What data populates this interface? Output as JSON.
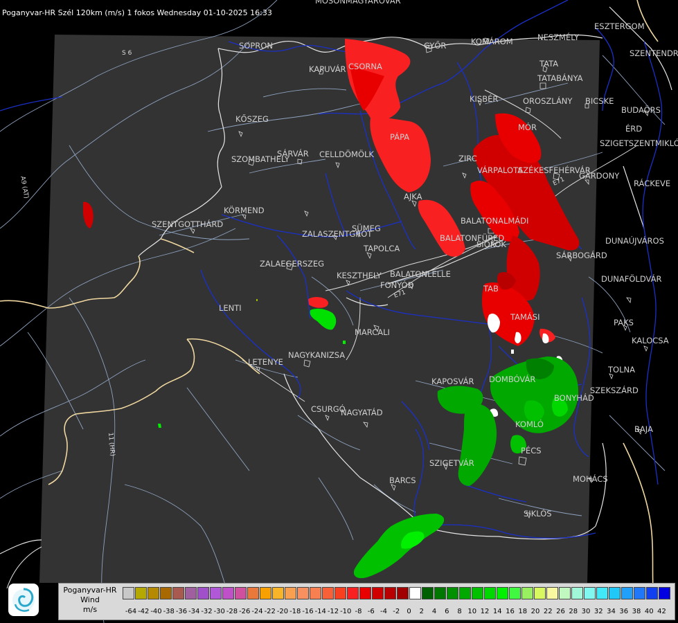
{
  "title": "Poganyvar-HR Szél 120km (m/s) 1 fokos Wednesday 01-10-2025 16:33",
  "legend": {
    "name_lines": [
      "Poganyvar-HR",
      "Wind",
      "m/s"
    ],
    "swatches": [
      {
        "v": "-64",
        "c": "#c8c8c8"
      },
      {
        "v": "-62",
        "c": "#b5a800"
      },
      {
        "v": "-42",
        "c": "#b58a00"
      },
      {
        "v": "-40",
        "c": "#a86a00"
      },
      {
        "v": "-38",
        "c": "#a85a50"
      },
      {
        "v": "-36",
        "c": "#a060a0"
      },
      {
        "v": "-34",
        "c": "#a050c8"
      },
      {
        "v": "-32",
        "c": "#b058d8"
      },
      {
        "v": "-30",
        "c": "#c050c8"
      },
      {
        "v": "-28",
        "c": "#d050a0"
      },
      {
        "v": "-26",
        "c": "#e8783c"
      },
      {
        "v": "-24",
        "c": "#f8a000"
      },
      {
        "v": "-22",
        "c": "#f8b428"
      },
      {
        "v": "-20",
        "c": "#f8a050"
      },
      {
        "v": "-18",
        "c": "#f89060"
      },
      {
        "v": "-16",
        "c": "#f88050"
      },
      {
        "v": "-14",
        "c": "#f86038"
      },
      {
        "v": "-12",
        "c": "#f84020"
      },
      {
        "v": "-10",
        "c": "#f82020"
      },
      {
        "v": "-8",
        "c": "#e80000"
      },
      {
        "v": "-6",
        "c": "#d00000"
      },
      {
        "v": "-4",
        "c": "#b80000"
      },
      {
        "v": "-2",
        "c": "#a00000"
      },
      {
        "v": "0",
        "c": "#ffffff"
      },
      {
        "v": "2",
        "c": "#006000"
      },
      {
        "v": "4",
        "c": "#007800"
      },
      {
        "v": "6",
        "c": "#009000"
      },
      {
        "v": "8",
        "c": "#00a800"
      },
      {
        "v": "10",
        "c": "#00c000"
      },
      {
        "v": "12",
        "c": "#00d800"
      },
      {
        "v": "14",
        "c": "#00f000"
      },
      {
        "v": "16",
        "c": "#40f840"
      },
      {
        "v": "18",
        "c": "#98f060"
      },
      {
        "v": "20",
        "c": "#d8f860"
      },
      {
        "v": "22",
        "c": "#f8f8a0"
      },
      {
        "v": "26",
        "c": "#c0f8c0"
      },
      {
        "v": "28",
        "c": "#a0f8d8"
      },
      {
        "v": "30",
        "c": "#80f8f0"
      },
      {
        "v": "32",
        "c": "#40e8f8"
      },
      {
        "v": "34",
        "c": "#20c8f8"
      },
      {
        "v": "36",
        "c": "#20a0f8"
      },
      {
        "v": "38",
        "c": "#2078f8"
      },
      {
        "v": "40",
        "c": "#1040f0"
      },
      {
        "v": "42",
        "c": "#0000e0"
      }
    ],
    "labels": [
      "-64",
      "-42",
      "-40",
      "-38",
      "-36",
      "-34",
      "-32",
      "-30",
      "-28",
      "-26",
      "-24",
      "-22",
      "-20",
      "-18",
      "-16",
      "-14",
      "-12",
      "-10",
      "-8",
      "-6",
      "-4",
      "-2",
      "0",
      "2",
      "4",
      "6",
      "8",
      "10",
      "12",
      "14",
      "16",
      "18",
      "20",
      "22",
      "26",
      "28",
      "30",
      "32",
      "34",
      "36",
      "38",
      "40",
      "42"
    ]
  },
  "places": [
    {
      "name": "MOSONMAGYARÓVÁR"
    },
    {
      "name": "SOPRON"
    },
    {
      "name": "KAPUVÁR"
    },
    {
      "name": "CSORNA"
    },
    {
      "name": "GYŐR"
    },
    {
      "name": "KOMÁROM"
    },
    {
      "name": "NESZMÉLY"
    },
    {
      "name": "ESZTERGOM"
    },
    {
      "name": "SZENTENDRE"
    },
    {
      "name": "TATA"
    },
    {
      "name": "TATABÁNYA"
    },
    {
      "name": "KISBÉR"
    },
    {
      "name": "OROSZLÁNY"
    },
    {
      "name": "BICSKE"
    },
    {
      "name": "BUDAÖRS"
    },
    {
      "name": "ÉRD"
    },
    {
      "name": "SZIGETSZENTMIKLÓS"
    },
    {
      "name": "MÓR"
    },
    {
      "name": "PÁPA"
    },
    {
      "name": "KŐSZEG"
    },
    {
      "name": "SÁRVÁR"
    },
    {
      "name": "CELLDÖMÖLK"
    },
    {
      "name": "SZOMBATHELY"
    },
    {
      "name": "ZIRC"
    },
    {
      "name": "VÁRPALOTA"
    },
    {
      "name": "SZÉKESFEHÉRVÁR"
    },
    {
      "name": "GÁRDONY"
    },
    {
      "name": "RÁCKEVE"
    },
    {
      "name": "AJKA"
    },
    {
      "name": "KÖRMEND"
    },
    {
      "name": "SZENTGOTTHÁRD"
    },
    {
      "name": "BALATONALMÁDI"
    },
    {
      "name": "SÜMEG"
    },
    {
      "name": "ZALASZENTGRÓT"
    },
    {
      "name": "BALATONFÜRED"
    },
    {
      "name": "SIÓFOK"
    },
    {
      "name": "DUNAÚJVÁROS"
    },
    {
      "name": "TAPOLCA"
    },
    {
      "name": "ZALAEGERSZEG"
    },
    {
      "name": "SÁRBOGÁRD"
    },
    {
      "name": "KESZTHELY"
    },
    {
      "name": "BALATONLELLE"
    },
    {
      "name": "FONYÓD"
    },
    {
      "name": "DUNAFÖLDVÁR"
    },
    {
      "name": "TAB"
    },
    {
      "name": "LENTI"
    },
    {
      "name": "TAMÁSI"
    },
    {
      "name": "PAKS"
    },
    {
      "name": "MARCALI"
    },
    {
      "name": "KALOCSA"
    },
    {
      "name": "NAGYKANIZSA"
    },
    {
      "name": "LETENYE"
    },
    {
      "name": "TOLNA"
    },
    {
      "name": "KAPOSVÁR"
    },
    {
      "name": "DOMBÓVÁR"
    },
    {
      "name": "SZEKSZÁRD"
    },
    {
      "name": "BONYHÁD"
    },
    {
      "name": "CSURGÓ"
    },
    {
      "name": "NAGYATÁD"
    },
    {
      "name": "KOMLÓ"
    },
    {
      "name": "BAJA"
    },
    {
      "name": "SZIGETVÁR"
    },
    {
      "name": "PÉCS"
    },
    {
      "name": "MOHÁCS"
    },
    {
      "name": "BARCS"
    },
    {
      "name": "SIKLÓS"
    }
  ],
  "roads": [
    {
      "name": "S 6"
    },
    {
      "name": "A9 (AT)"
    },
    {
      "name": "11 (HR)"
    },
    {
      "name": "E71"
    },
    {
      "name": "E71"
    }
  ]
}
